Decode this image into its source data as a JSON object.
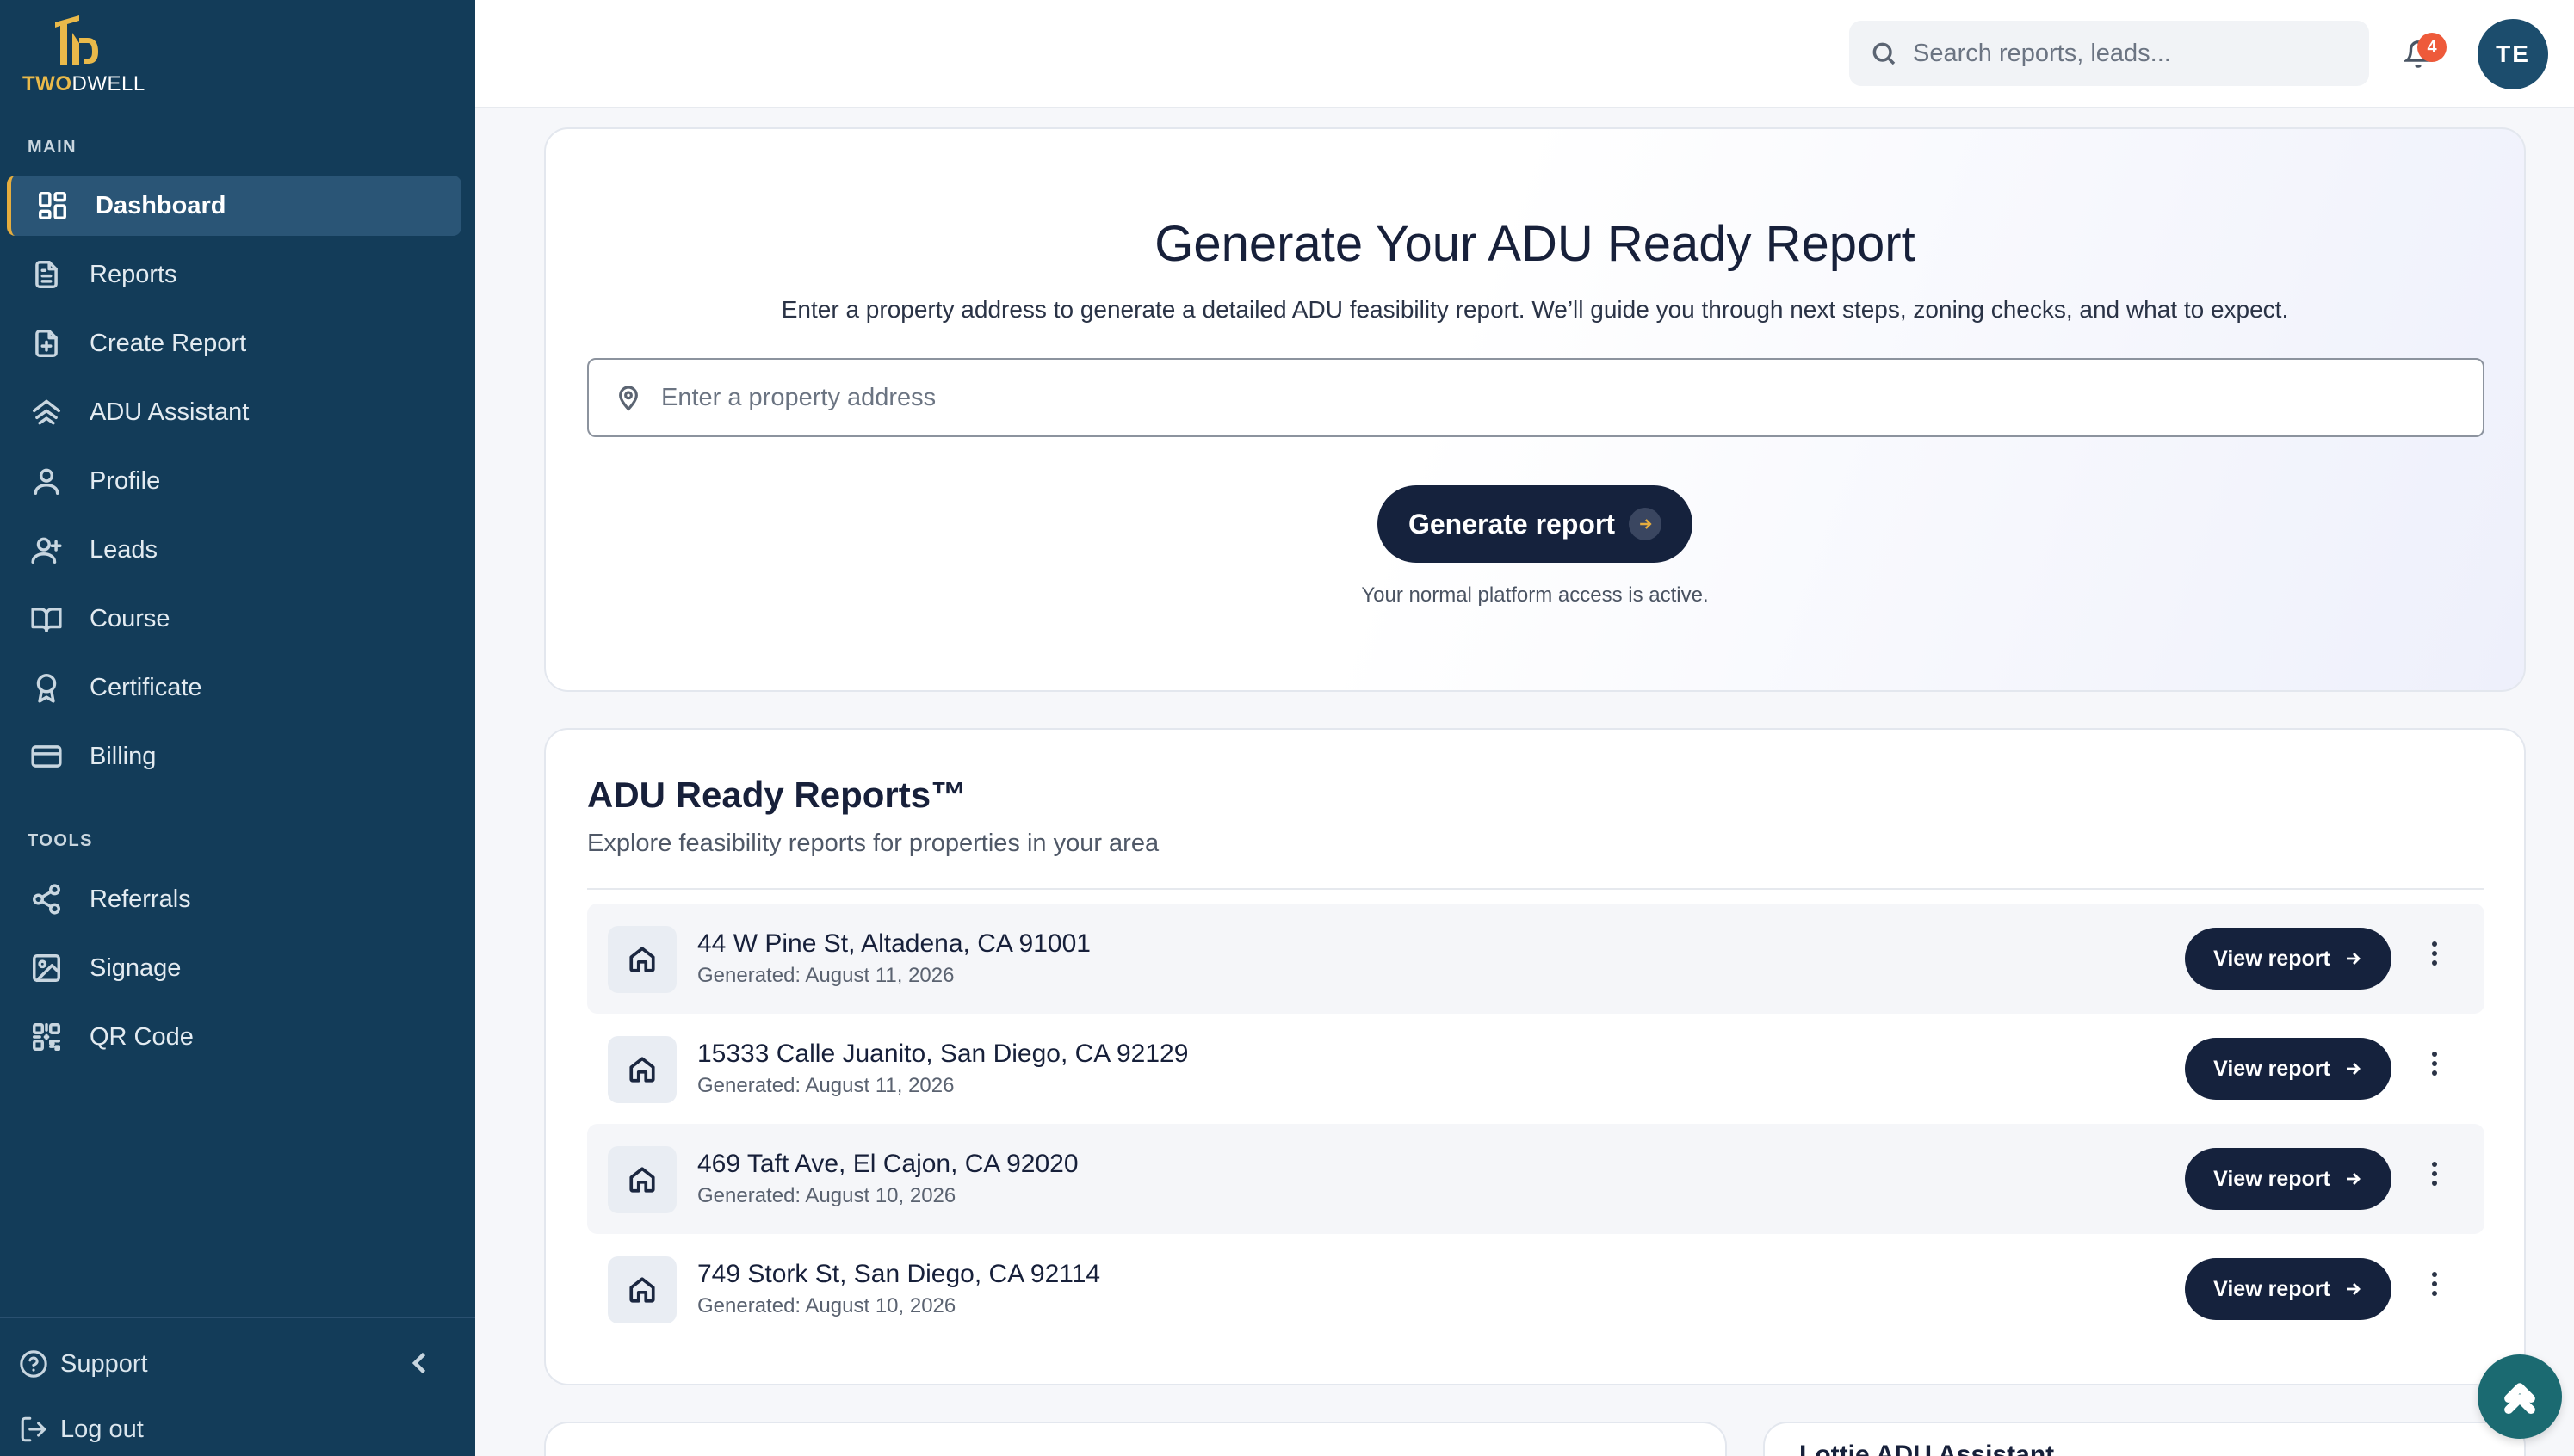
{
  "brand": {
    "name_primary": "TWO",
    "name_secondary": "DWELL"
  },
  "sidebar": {
    "main_label": "MAIN",
    "tools_label": "TOOLS",
    "main_items": [
      {
        "label": "Dashboard",
        "icon": "dashboard-icon",
        "active": true
      },
      {
        "label": "Reports",
        "icon": "document-icon"
      },
      {
        "label": "Create Report",
        "icon": "document-plus-icon"
      },
      {
        "label": "ADU Assistant",
        "icon": "house-stack-icon"
      },
      {
        "label": "Profile",
        "icon": "user-icon"
      },
      {
        "label": "Leads",
        "icon": "user-plus-icon"
      },
      {
        "label": "Course",
        "icon": "book-icon"
      },
      {
        "label": "Certificate",
        "icon": "award-icon"
      },
      {
        "label": "Billing",
        "icon": "credit-card-icon"
      }
    ],
    "tools_items": [
      {
        "label": "Referrals",
        "icon": "share-icon"
      },
      {
        "label": "Signage",
        "icon": "image-icon"
      },
      {
        "label": "QR Code",
        "icon": "qr-code-icon"
      }
    ],
    "support_label": "Support",
    "logout_label": "Log out"
  },
  "header": {
    "search_placeholder": "Search reports, leads...",
    "notification_count": "4",
    "avatar_initials": "TE"
  },
  "hero": {
    "title": "Generate Your ADU Ready Report",
    "subtitle": "Enter a property address to generate a detailed ADU feasibility report. We’ll guide you through next steps, zoning checks, and what to expect.",
    "address_placeholder": "Enter a property address",
    "button_label": "Generate report",
    "note": "Your normal platform access is active."
  },
  "reports": {
    "title": "ADU Ready Reports™",
    "subtitle": "Explore feasibility reports for properties in your area",
    "view_label": "View report",
    "items": [
      {
        "address": "44 W Pine St, Altadena, CA 91001",
        "generated": "Generated: August 11, 2026"
      },
      {
        "address": "15333 Calle Juanito, San Diego, CA 92129",
        "generated": "Generated: August 11, 2026"
      },
      {
        "address": "469 Taft Ave, El Cajon, CA 92020",
        "generated": "Generated: August 10, 2026"
      },
      {
        "address": "749 Stork St, San Diego, CA 92114",
        "generated": "Generated: August 10, 2026"
      }
    ]
  },
  "assistant_card": {
    "title": "Lottie ADU Assistant"
  },
  "colors": {
    "sidebar": "#133c59",
    "accent": "#e5ad3e",
    "primary_button": "#15223d",
    "badge": "#ee5a3a"
  }
}
